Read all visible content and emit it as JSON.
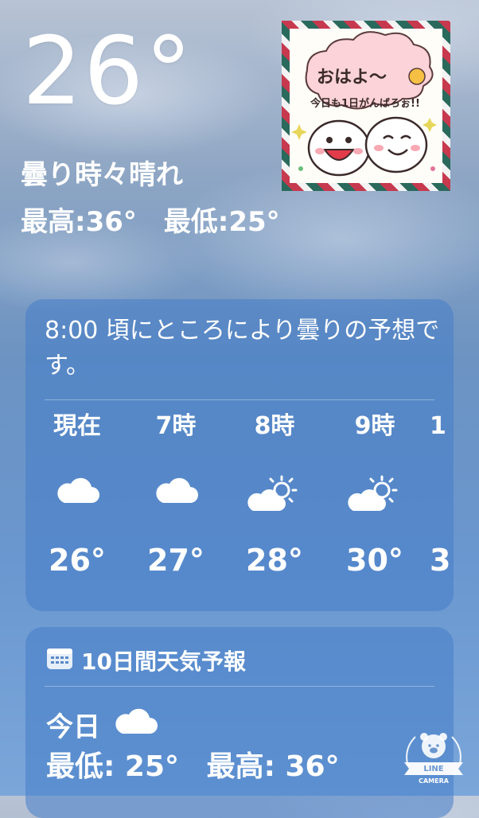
{
  "current": {
    "temperature": "26°",
    "condition": "曇り時々晴れ",
    "high": "最高:36°",
    "low": "最低:25°"
  },
  "sticker": {
    "line1": "おはよ〜",
    "line2": "今日も1日がんばろぉ!!"
  },
  "hourly": {
    "summary": "8:00 頃にところにより曇りの予想です。",
    "hours": [
      {
        "label": "現在",
        "icon": "cloud-icon",
        "temp": "26°"
      },
      {
        "label": "7時",
        "icon": "cloud-icon",
        "temp": "27°"
      },
      {
        "label": "8時",
        "icon": "partly-sunny-icon",
        "temp": "28°"
      },
      {
        "label": "9時",
        "icon": "partly-sunny-icon",
        "temp": "30°"
      },
      {
        "label": "1",
        "icon": "",
        "temp": "3"
      }
    ]
  },
  "daily": {
    "header": "10日間天気予報",
    "today": {
      "label": "今日",
      "icon": "cloud-icon",
      "low": "最低: 25°",
      "high": "最高: 36°"
    }
  },
  "watermark": {
    "line1": "LINE",
    "line2": "CAMERA"
  }
}
